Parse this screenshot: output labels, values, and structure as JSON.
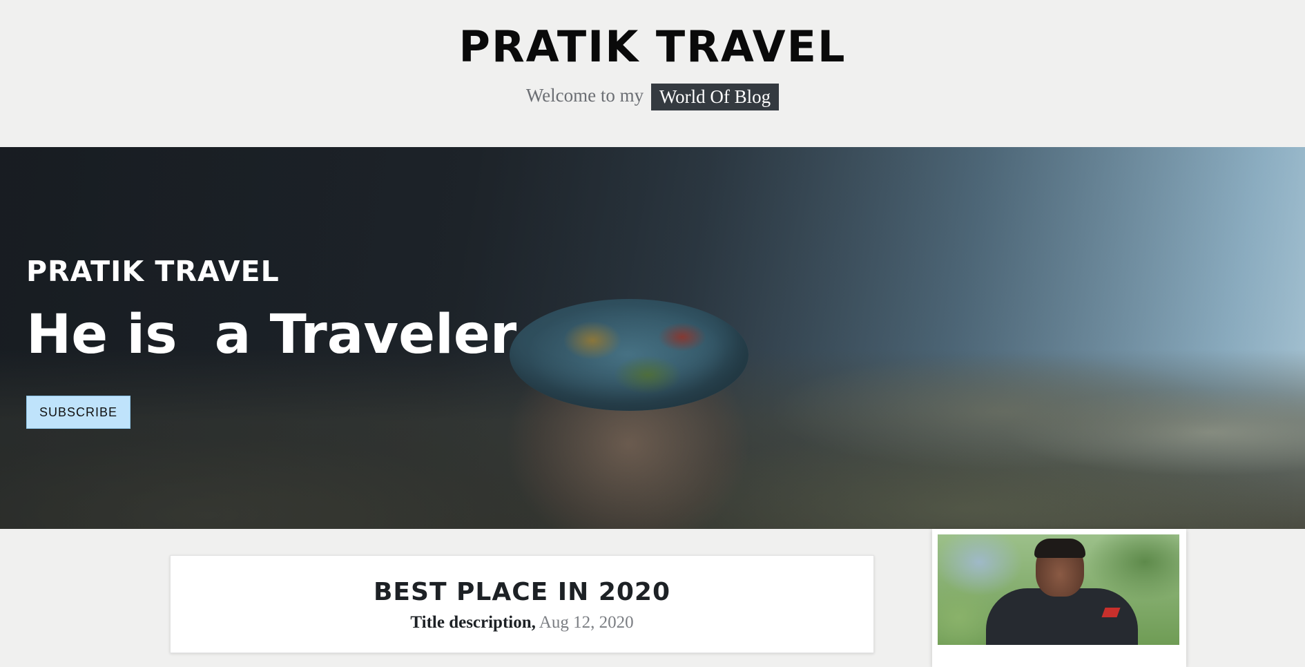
{
  "header": {
    "site_title": "PRATIK TRAVEL",
    "tagline_prefix": "Welcome to my",
    "tagline_badge": "World Of Blog"
  },
  "hero": {
    "brand": "PRATIK TRAVEL",
    "heading": "He is  a Traveler",
    "subscribe_label": "SUBSCRIBE",
    "subscribe_color": "#bfe3fb"
  },
  "post": {
    "title": "BEST PLACE IN 2020",
    "description": "Title description,",
    "date": "Aug 12, 2020"
  },
  "colors": {
    "page_background": "#f0f0ef",
    "badge_background": "#343a40"
  }
}
